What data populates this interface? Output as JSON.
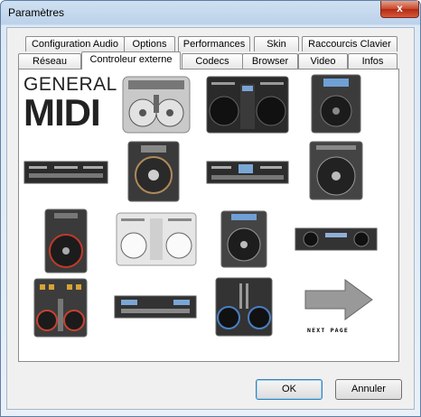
{
  "window": {
    "title": "Paramètres",
    "close_glyph": "x"
  },
  "tabs_top": [
    {
      "label": "Configuration Audio"
    },
    {
      "label": "Options"
    },
    {
      "label": "Performances"
    },
    {
      "label": "Skin"
    },
    {
      "label": "Raccourcis Clavier"
    }
  ],
  "tabs_bottom": [
    {
      "label": "Réseau"
    },
    {
      "label": "Controleur externe",
      "selected": true
    },
    {
      "label": "Codecs"
    },
    {
      "label": "Browser"
    },
    {
      "label": "Video"
    },
    {
      "label": "Infos"
    }
  ],
  "panel": {
    "logo": {
      "line1": "GENERAL",
      "line2": "MIDI"
    },
    "next_page_label": "NEXT PAGE"
  },
  "buttons": {
    "ok": "OK",
    "cancel": "Annuler"
  }
}
